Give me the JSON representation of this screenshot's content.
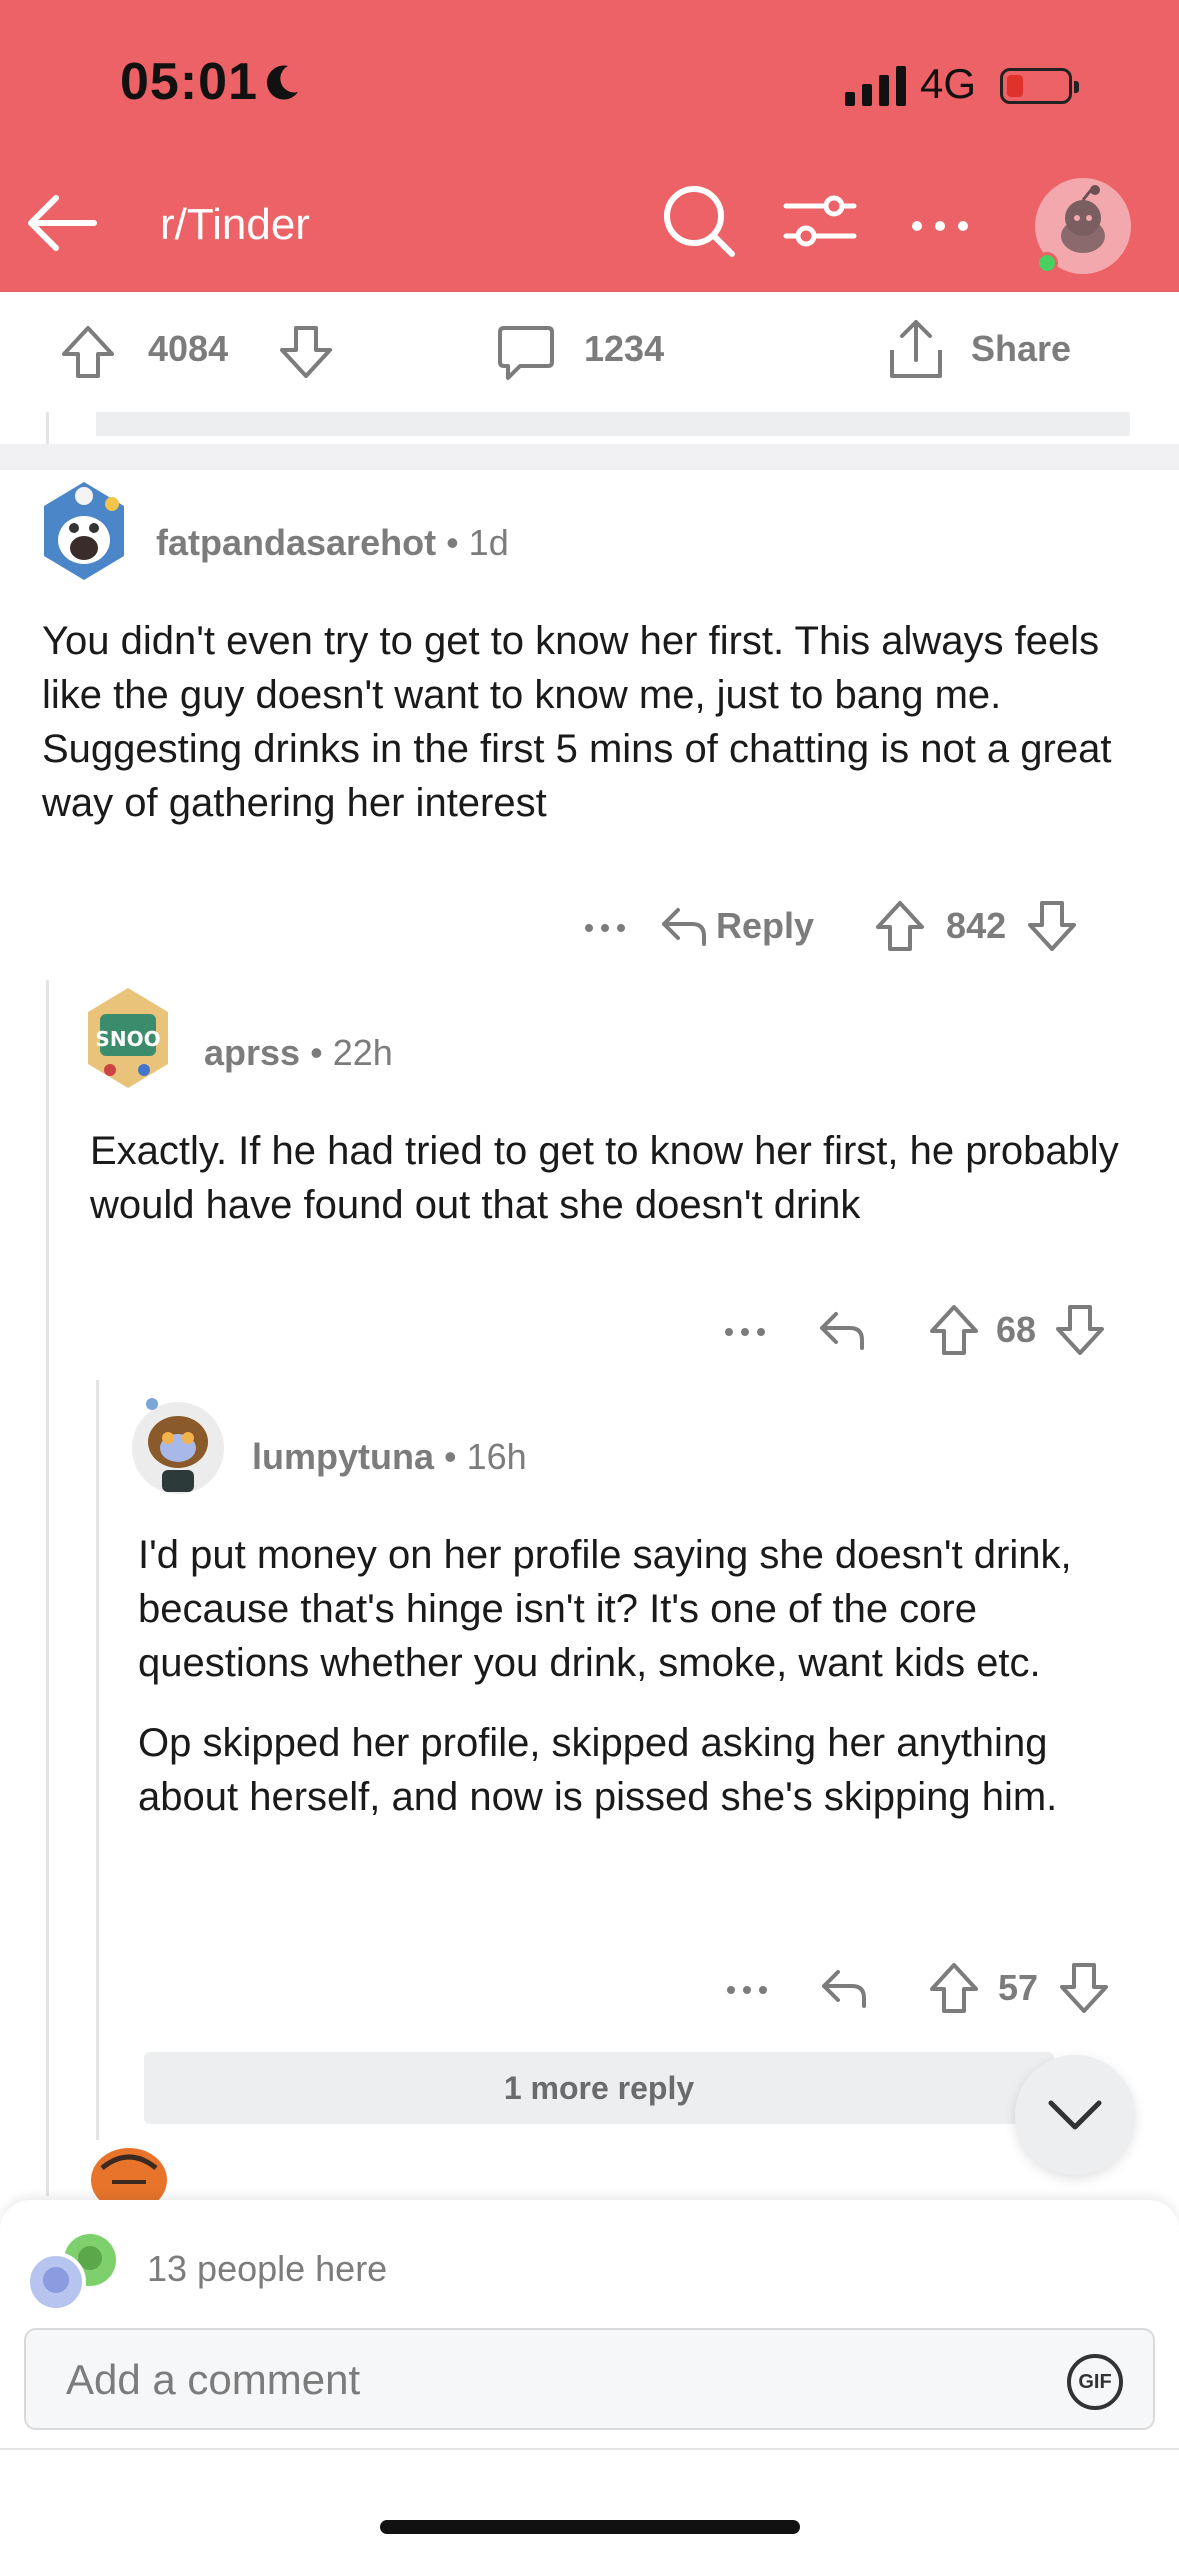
{
  "status_bar": {
    "time": "05:01",
    "network": "4G"
  },
  "header": {
    "subreddit": "r/Tinder",
    "accent_color": "#ec6266"
  },
  "post_actions": {
    "upvotes": "4084",
    "comments": "1234",
    "share_label": "Share"
  },
  "comments": [
    {
      "username": "fatpandasarehot",
      "age": "1d",
      "body": [
        "You didn't even try to get to know her first.  This always feels like the guy doesn't want to know me, just to bang me.  Suggesting drinks in the first 5 mins of chatting is not a great way of gathering her interest"
      ],
      "reply_label": "Reply",
      "score": "842"
    },
    {
      "username": "aprss",
      "age": "22h",
      "body": [
        "Exactly. If he had tried to get to know her first, he probably would have found out that she doesn't drink"
      ],
      "score": "68"
    },
    {
      "username": "lumpytuna",
      "age": "16h",
      "body": [
        "I'd put money on her profile saying she doesn't drink, because that's hinge isn't it? It's one of the core questions whether you drink, smoke, want kids etc.",
        "Op skipped her profile, skipped asking her anything about herself, and now is pissed she's skipping him."
      ],
      "score": "57"
    }
  ],
  "more_replies_label": "1 more reply",
  "presence": {
    "text": "13 people here"
  },
  "composer": {
    "placeholder": "Add a comment",
    "gif_label": "GIF"
  }
}
